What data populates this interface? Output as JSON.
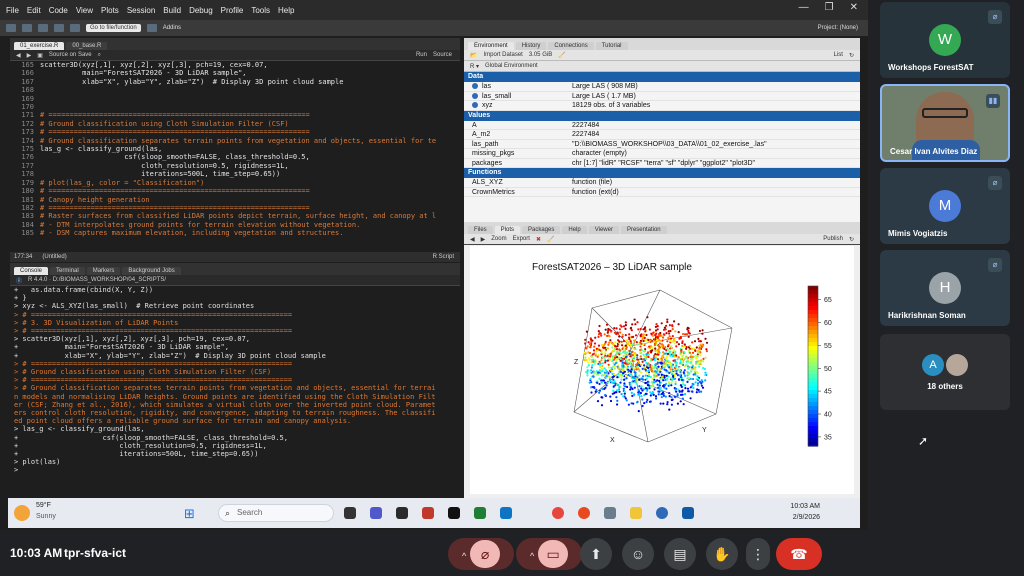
{
  "rstudio": {
    "menu": [
      "File",
      "Edit",
      "Code",
      "View",
      "Plots",
      "Session",
      "Build",
      "Debug",
      "Profile",
      "Tools",
      "Help"
    ],
    "toolbar": {
      "goto_placeholder": "Go to file/function",
      "addins": "Addins",
      "project": "Project: (None)"
    },
    "source": {
      "tabs": [
        "01_exercise.R",
        "00_base.R"
      ],
      "toolbar": {
        "source_on_save": "Source on Save",
        "run": "Run",
        "source": "Source"
      },
      "lines": [
        {
          "n": "165",
          "t": "scatter3D(xyz[,1], xyz[,2], xyz[,3], pch=19, cex=0.07,",
          "c": false
        },
        {
          "n": "166",
          "t": "          main=\"ForestSAT2026 - 3D LiDAR sample\",",
          "c": false
        },
        {
          "n": "167",
          "t": "          xlab=\"X\", ylab=\"Y\", zlab=\"Z\")  # Display 3D point cloud sample",
          "c": false
        },
        {
          "n": "168",
          "t": "",
          "c": false
        },
        {
          "n": "169",
          "t": "",
          "c": false
        },
        {
          "n": "170",
          "t": "",
          "c": false
        },
        {
          "n": "171",
          "t": "# ==============================================================",
          "c": true
        },
        {
          "n": "172",
          "t": "# Ground classification using Cloth Simulation Filter (CSF)",
          "c": true
        },
        {
          "n": "173",
          "t": "# ==============================================================",
          "c": true
        },
        {
          "n": "174",
          "t": "# Ground classification separates terrain points from vegetation and objects, essential for te",
          "c": true
        },
        {
          "n": "175",
          "t": "las_g <- classify_ground(las,",
          "c": false
        },
        {
          "n": "176",
          "t": "                    csf(sloop_smooth=FALSE, class_threshold=0.5,",
          "c": false
        },
        {
          "n": "177",
          "t": "                        cloth_resolution=0.5, rigidness=1L,",
          "c": false
        },
        {
          "n": "178",
          "t": "                        iterations=500L, time_step=0.65))",
          "c": false
        },
        {
          "n": "179",
          "t": "# plot(las_g, color = \"Classification\")",
          "c": true
        },
        {
          "n": "180",
          "t": "# ==============================================================",
          "c": true
        },
        {
          "n": "181",
          "t": "# Canopy height generation",
          "c": true
        },
        {
          "n": "182",
          "t": "# ==============================================================",
          "c": true
        },
        {
          "n": "183",
          "t": "# Raster surfaces from classified LiDAR points depict terrain, surface height, and canopy at l",
          "c": true
        },
        {
          "n": "184",
          "t": "# - DTM interpolates ground points for terrain elevation without vegetation.",
          "c": true
        },
        {
          "n": "185",
          "t": "# - DSM captures maximum elevation, including vegetation and structures.",
          "c": true
        }
      ],
      "status_pos": "177:34",
      "status_ctx": "(Untitled)",
      "status_type": "R Script"
    },
    "console": {
      "tabs": [
        "Console",
        "Terminal",
        "Markers",
        "Background Jobs"
      ],
      "path": "R 4.4.0 · D:/BIOMASS_WORKSHOP/04_SCRIPTS/",
      "lines": [
        {
          "t": "+   as.data.frame(cbind(X, Y, Z))",
          "c": false
        },
        {
          "t": "+ }",
          "c": false
        },
        {
          "t": "> xyz <- ALS_XYZ(las_small)  # Retrieve point coordinates",
          "c": false
        },
        {
          "t": "> # ==============================================================",
          "c": true
        },
        {
          "t": "> # 3. 3D Visualization of LiDAR Points",
          "c": true
        },
        {
          "t": "> # ==============================================================",
          "c": true
        },
        {
          "t": "> scatter3D(xyz[,1], xyz[,2], xyz[,3], pch=19, cex=0.07,",
          "c": false
        },
        {
          "t": "+           main=\"ForestSAT2026 - 3D LiDAR sample\",",
          "c": false
        },
        {
          "t": "+           xlab=\"X\", ylab=\"Y\", zlab=\"Z\")  # Display 3D point cloud sample",
          "c": false
        },
        {
          "t": "> # ==============================================================",
          "c": true
        },
        {
          "t": "> # Ground classification using Cloth Simulation Filter (CSF)",
          "c": true
        },
        {
          "t": "> # ==============================================================",
          "c": true
        },
        {
          "t": "> # Ground classification separates terrain points from vegetation and objects, essential for terrai",
          "c": true
        },
        {
          "t": "n models and normalising LiDAR heights. Ground points are identified using the Cloth Simulation Filt",
          "c": true
        },
        {
          "t": "er (CSF; Zhang et al., 2016), which simulates a virtual cloth over the inverted point cloud. Paramet",
          "c": true
        },
        {
          "t": "ers control cloth resolution, rigidity, and convergence, adapting to terrain roughness. The classifi",
          "c": true
        },
        {
          "t": "ed point cloud offers a reliable ground surface for terrain and canopy analysis.",
          "c": true
        },
        {
          "t": "> las_g <- classify_ground(las,",
          "c": false
        },
        {
          "t": "+                    csf(sloop_smooth=FALSE, class_threshold=0.5,",
          "c": false
        },
        {
          "t": "+                        cloth_resolution=0.5, rigidness=1L,",
          "c": false
        },
        {
          "t": "+                        iterations=500L, time_step=0.65))",
          "c": false
        },
        {
          "t": "",
          "c": false
        },
        {
          "t": "> plot(las)",
          "c": false
        },
        {
          "t": ">",
          "c": false
        }
      ]
    },
    "environment": {
      "tabs": [
        "Environment",
        "History",
        "Connections",
        "Tutorial"
      ],
      "toolbar": {
        "import": "Import Dataset",
        "memory": "3.05 GiB",
        "scope": "Global Environment",
        "view": "List"
      },
      "data_header": "Data",
      "data": [
        {
          "name": "las",
          "value": "Large LAS ( 908 MB)"
        },
        {
          "name": "las_small",
          "value": "Large LAS ( 1.7 MB)"
        },
        {
          "name": "xyz",
          "value": "18129 obs. of 3 variables"
        }
      ],
      "values_header": "Values",
      "values": [
        {
          "name": "A",
          "value": "2227484"
        },
        {
          "name": "A_m2",
          "value": "2227484"
        },
        {
          "name": "las_path",
          "value": "\"D:\\\\BIOMASS_WORKSHOP\\\\03_DATA\\\\01_02_exercise_.las\""
        },
        {
          "name": "missing_pkgs",
          "value": "character (empty)"
        },
        {
          "name": "packages",
          "value": "chr [1:7] \"lidR\" \"RCSF\" \"terra\" \"sf\" \"dplyr\" \"ggplot2\" \"plot3D\""
        }
      ],
      "functions_header": "Functions",
      "functions": [
        {
          "name": "ALS_XYZ",
          "value": "function (file)"
        },
        {
          "name": "CrownMetrics",
          "value": "function (ext(d)"
        }
      ]
    },
    "plots": {
      "tabs": [
        "Files",
        "Plots",
        "Packages",
        "Help",
        "Viewer",
        "Presentation"
      ],
      "toolbar": {
        "zoom": "Zoom",
        "export": "Export",
        "publish": "Publish"
      }
    }
  },
  "chart_data": {
    "type": "scatter",
    "title": "ForestSAT2026 – 3D LiDAR sample",
    "xlabel": "X",
    "ylabel": "Y",
    "zlabel": "Z",
    "colorbar": {
      "ticks": [
        35,
        40,
        45,
        50,
        55,
        60,
        65
      ],
      "range": [
        33,
        68
      ],
      "palette": "jet"
    },
    "points": 18129
  },
  "taskbar": {
    "weather_temp": "59°F",
    "weather_desc": "Sunny",
    "search_placeholder": "Search",
    "time": "10:03 AM",
    "date": "2/9/2026"
  },
  "meeting": {
    "clock": "10:03 AM",
    "meeting_id": "tpr-sfva-ict",
    "participants": [
      {
        "initial": "W",
        "name": "Workshops ForestSAT",
        "color": "#34a853"
      },
      {
        "initial": "",
        "name": "Cesar Ivan Alvites Diaz",
        "color": "#5d7b8a"
      },
      {
        "initial": "M",
        "name": "Mimis Vogiatzis",
        "color": "#4b7bd6"
      },
      {
        "initial": "H",
        "name": "Harikrishnan Soman",
        "color": "#9aa3a8"
      }
    ],
    "others_label": "18 others",
    "others_initial": "A"
  }
}
